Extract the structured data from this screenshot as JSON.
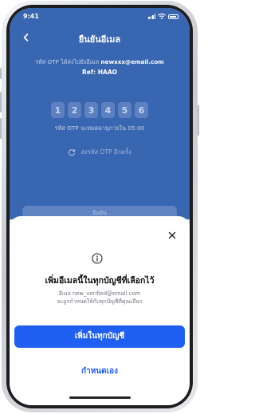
{
  "status_bar": {
    "time": "9:41",
    "signal_icon": "signal-icon",
    "wifi_icon": "wifi-icon",
    "battery_icon": "battery-icon"
  },
  "header": {
    "title": "ยืนยันอีเมล",
    "back_icon": "chevron-left-icon"
  },
  "otp_screen": {
    "sent_text": "รหัส OTP ได้ส่งไปยังอีเมล",
    "email": "newxxx@email.com",
    "ref": "Ref: HAAO",
    "digits": [
      "1",
      "2",
      "3",
      "4",
      "5",
      "6"
    ],
    "expiry": "รหัส OTP จะหมดอายุภายใน 05:00",
    "resend_label": "ส่งรหัส OTP อีกครั้ง",
    "confirm_label": "ยืนยัน"
  },
  "sheet": {
    "close_icon": "close-icon",
    "info_icon": "info-icon",
    "title": "เพิ่มอีเมลนี้ในทุกบัญชีที่เลือกไว้",
    "description_line1": "อีเมล new_verified@email.com",
    "description_line2": "จะถูกกำหนดให้กับทุกบัญชีที่คุณเลือก",
    "primary_label": "เพิ่มในทุกบัญชี",
    "secondary_label": "กำหนดเอง"
  },
  "colors": {
    "primary": "#1F5FF2",
    "header_bg": "#3866B0",
    "text_dark": "#111111"
  }
}
